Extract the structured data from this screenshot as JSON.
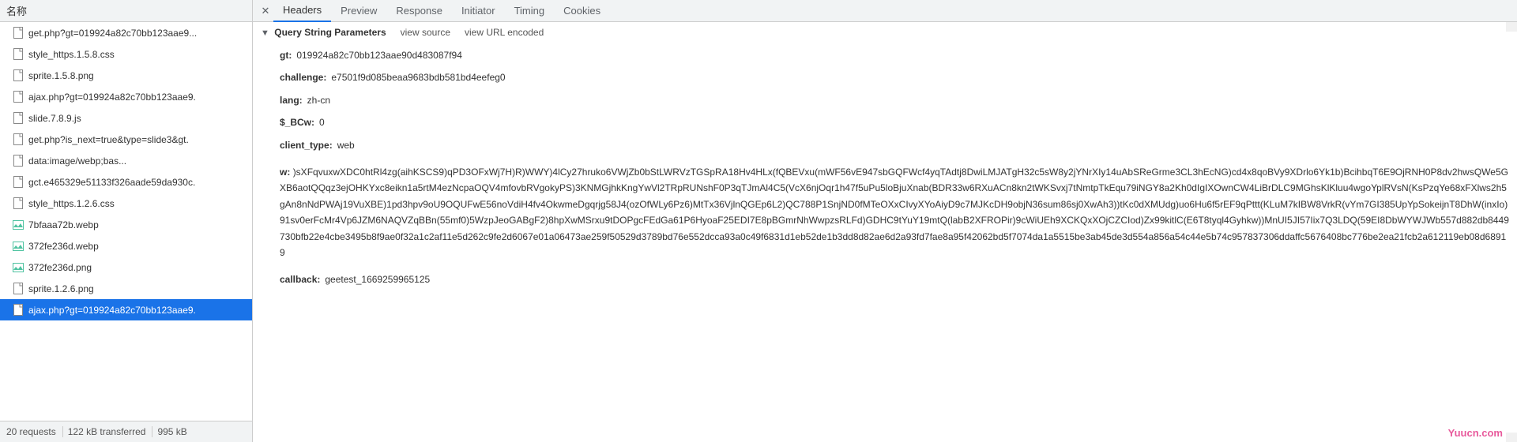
{
  "left": {
    "header": "名称",
    "files": [
      {
        "name": "get.php?gt=019924a82c70bb123aae9...",
        "type": "doc"
      },
      {
        "name": "style_https.1.5.8.css",
        "type": "doc"
      },
      {
        "name": "sprite.1.5.8.png",
        "type": "doc"
      },
      {
        "name": "ajax.php?gt=019924a82c70bb123aae9.",
        "type": "doc"
      },
      {
        "name": "slide.7.8.9.js",
        "type": "doc"
      },
      {
        "name": "get.php?is_next=true&type=slide3&gt.",
        "type": "doc"
      },
      {
        "name": "data:image/webp;bas...",
        "type": "doc"
      },
      {
        "name": "gct.e465329e51133f326aade59da930c.",
        "type": "doc"
      },
      {
        "name": "style_https.1.2.6.css",
        "type": "doc"
      },
      {
        "name": "7bfaaa72b.webp",
        "type": "img"
      },
      {
        "name": "372fe236d.webp",
        "type": "img"
      },
      {
        "name": "372fe236d.png",
        "type": "img"
      },
      {
        "name": "sprite.1.2.6.png",
        "type": "doc"
      },
      {
        "name": "ajax.php?gt=019924a82c70bb123aae9.",
        "type": "doc",
        "selected": true
      }
    ],
    "footer": [
      "20 requests",
      "122 kB transferred",
      "995 kB"
    ]
  },
  "tabs": {
    "items": [
      "Headers",
      "Preview",
      "Response",
      "Initiator",
      "Timing",
      "Cookies"
    ],
    "active": 0
  },
  "section": {
    "title": "Query String Parameters",
    "view_source": "view source",
    "view_url": "view URL encoded"
  },
  "params": {
    "gt": "019924a82c70bb123aae90d483087f94",
    "challenge": "e7501f9d085beaa9683bdb581bd4eefeg0",
    "lang": "zh-cn",
    "bcw": "0",
    "client_type": "web",
    "w": ")sXFqvuxwXDC0htRl4zg(aihKSCS9)qPD3OFxWj7H)R)WWY)4lCy27hruko6VWjZb0bStLWRVzTGSpRA18Hv4HLx(fQBEVxu(mWF56vE947sbGQFWcf4yqTAdtj8DwiLMJATgH32c5sW8y2jYNrXIy14uAbSReGrme3CL3hEcNG)cd4x8qoBVy9XDrlo6Yk1b)BcihbqT6E9OjRNH0P8dv2hwsQWe5GXB6aotQQqz3ejOHKYxc8eikn1a5rtM4ezNcpaOQV4mfovbRVgokyPS)3KNMGjhkKngYwVl2TRpRUNshF0P3qTJmAl4C5(VcX6njOqr1h47f5uPu5loBjuXnab(BDR33w6RXuACn8kn2tWKSvxj7tNmtpTkEqu79iNGY8a2Kh0dIgIXOwnCW4LiBrDLC9MGhsKlKluu4wgoYplRVsN(KsPzqYe68xFXlws2h5gAn8nNdPWAj19VuXBE)1pd3hpv9oU9OQUFwE56noVdiH4fv4OkwmeDgqrjg58J4(ozOfWLy6Pz6)MtTx36VjlnQGEp6L2)QC788P1SnjND0fMTeOXxCIvyXYoAiyD9c7MJKcDH9objN36sum86sj0XwAh3))tKc0dXMUdg)uo6Hu6f5rEF9qPttt(KLuM7kIBW8VrkR(vYm7GI385UpYpSokeijnT8DhW(inxIo)91sv0erFcMr4Vp6JZM6NAQVZqBBn(55mf0)5WzpJeoGABgF2)8hpXwMSrxu9tDOPgcFEdGa61P6HyoaF25EDI7E8pBGmrNhWwpzsRLFd)GDHC9tYuY19mtQ(labB2XFROPir)9cWiUEh9XCKQxXOjCZCIod)Zx99kitlC(E6T8tyql4Gyhkw))MnUI5JI57Iix7Q3LDQ(59EI8DbWYWJWb557d882db8449730bfb22e4cbe3495b8f9ae0f32a1c2af11e5d262c9fe2d6067e01a06473ae259f50529d3789bd76e552dcca93a0c49f6831d1eb52de1b3dd8d82ae6d2a93fd7fae8a95f42062bd5f7074da1a5515be3ab45de3d554a856a54c44e5b74c957837306ddaffc5676408bc776be2ea21fcb2a612119eb08d68919",
    "callback": "geetest_1669259965125"
  },
  "watermark": "Yuucn.com"
}
